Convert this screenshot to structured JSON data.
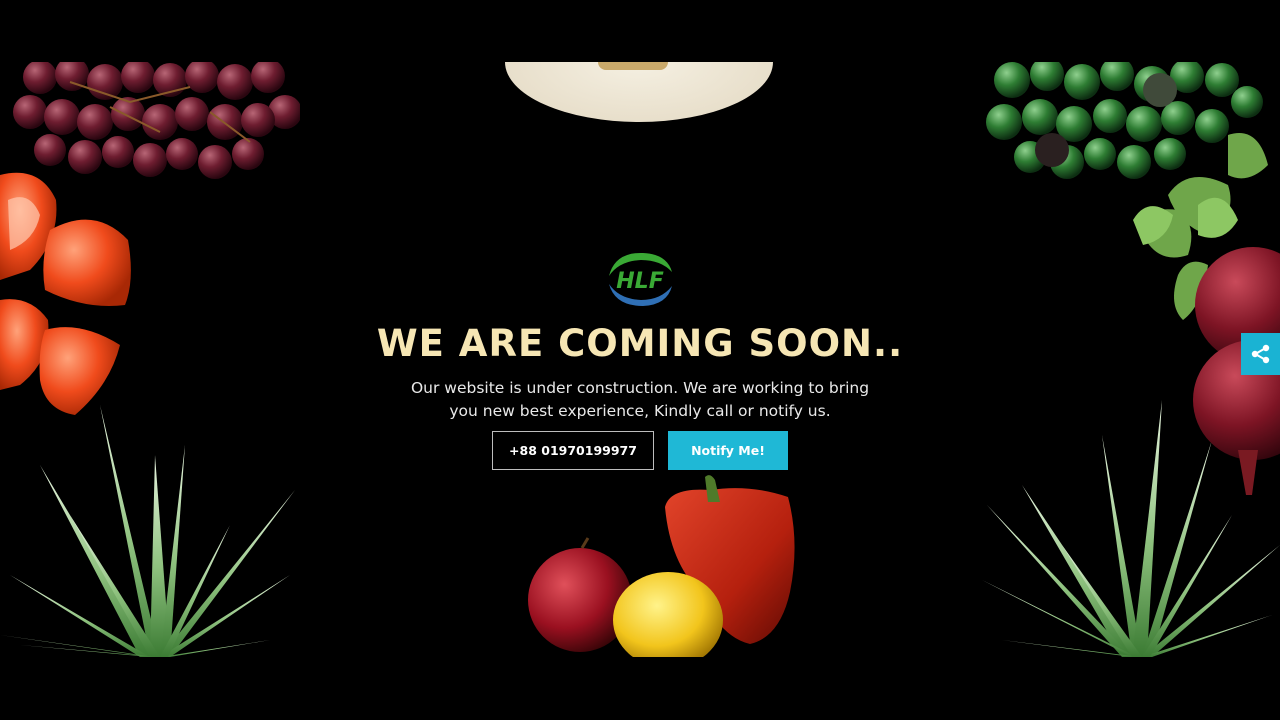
{
  "hero": {
    "logo_text": "HLF",
    "title": "WE ARE COMING SOON..",
    "subtitle_line1": "Our website is under construction. We are working to bring",
    "subtitle_line2": "you new best experience, Kindly call or notify us."
  },
  "actions": {
    "phone_label": "+88 01970199977",
    "notify_label": "Notify Me!"
  },
  "share": {
    "icon": "share-icon"
  },
  "colors": {
    "background": "#000000",
    "title": "#f6e6b4",
    "accent": "#1fb8d6",
    "logo_green": "#3aa935",
    "logo_blue": "#2f6fb5"
  }
}
